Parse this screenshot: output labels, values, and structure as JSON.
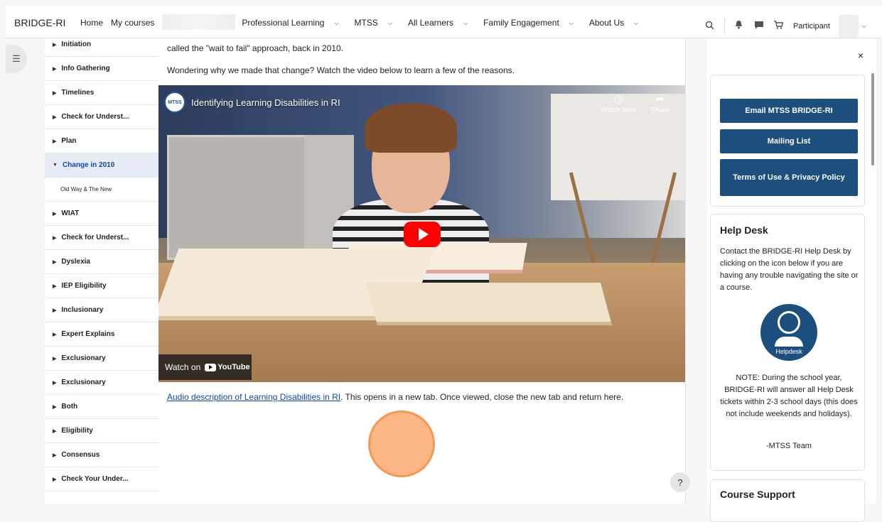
{
  "topbar": {
    "brand": "BRIDGE-RI",
    "nav": [
      "Home",
      "My courses"
    ],
    "menus": [
      "Professional Learning",
      "MTSS",
      "All Learners",
      "Family Engagement",
      "About Us"
    ],
    "role": "Participant"
  },
  "course_index": {
    "items": [
      {
        "label": "Initiation"
      },
      {
        "label": "Info Gathering"
      },
      {
        "label": "Timelines"
      },
      {
        "label": "Check for Underst..."
      },
      {
        "label": "Plan"
      },
      {
        "label": "Change in 2010",
        "active": true
      },
      {
        "label": "Old Way & The New",
        "sub": true
      },
      {
        "label": "WIAT"
      },
      {
        "label": "Check for Underst..."
      },
      {
        "label": "Dyslexia"
      },
      {
        "label": "IEP Eligibility"
      },
      {
        "label": "Inclusionary"
      },
      {
        "label": "Expert Explains"
      },
      {
        "label": "Exclusionary"
      },
      {
        "label": "Exclusionary"
      },
      {
        "label": "Both"
      },
      {
        "label": "Eligibility"
      },
      {
        "label": "Consensus"
      },
      {
        "label": "Check Your Under..."
      }
    ]
  },
  "main": {
    "para1": "called the \"wait to fail\" approach, back in 2010.",
    "para2": "Wondering why we made that change? Watch the video below to learn a few of the reasons.",
    "video": {
      "channel_badge": "MTSS",
      "title": "Identifying Learning Disabilities in RI",
      "watch_later": "Watch later",
      "share": "Share",
      "watch_on": "Watch on",
      "youtube": "YouTube"
    },
    "audio_link": "Audio description of Learning Disabilities in RI",
    "audio_rest": ". This opens in a new tab. Once viewed, close the new tab and return here.",
    "help_button": "?"
  },
  "right_drawer": {
    "close": "×",
    "buttons": [
      "Email MTSS BRIDGE-RI",
      "Mailing List",
      "Terms of Use & Privacy Policy"
    ],
    "helpdesk": {
      "title": "Help Desk",
      "text": "Contact the BRIDGE-RI Help Desk by clicking on the icon below if you are having any trouble navigating the site or a course.",
      "icon_label": "Helpdesk",
      "note": "NOTE: During the school year, BRIDGE-RI will answer all Help Desk tickets within 2-3 school days (this does not include weekends and holidays).",
      "sign": "-MTSS Team"
    },
    "course_support_title": "Course Support"
  },
  "colors": {
    "accent": "#1c4e7e",
    "link": "#0f47ad",
    "youtube_red": "#ff0000",
    "click_marker": "#f7a061"
  }
}
